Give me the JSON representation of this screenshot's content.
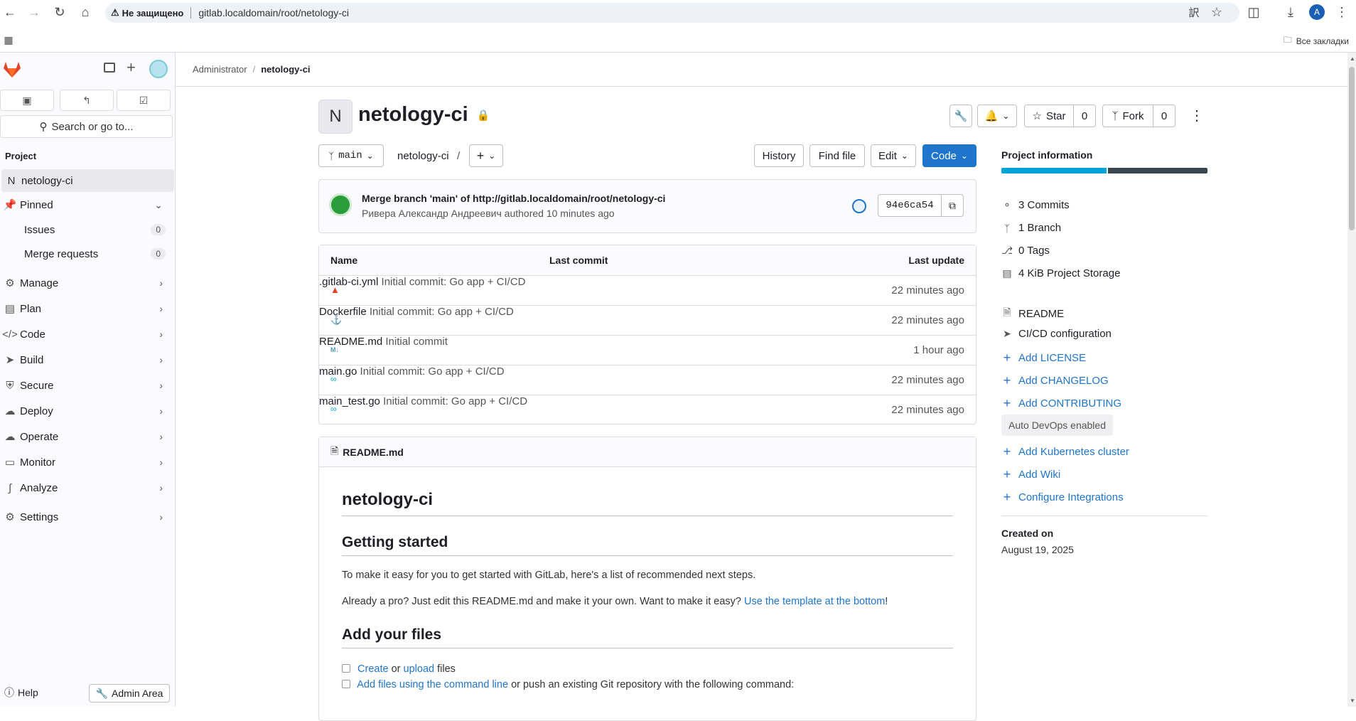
{
  "browser": {
    "security_label": "Не защищено",
    "url": "gitlab.localdomain/root/netology-ci",
    "bookmarks_label": "Все закладки",
    "profile_initial": "A"
  },
  "sidebar": {
    "search_label": "Search or go to...",
    "section_label": "Project",
    "project_initial": "N",
    "project_name": "netology-ci",
    "pinned_label": "Pinned",
    "issues_label": "Issues",
    "issues_count": "0",
    "mr_label": "Merge requests",
    "mr_count": "0",
    "items": [
      {
        "label": "Manage"
      },
      {
        "label": "Plan"
      },
      {
        "label": "Code"
      },
      {
        "label": "Build"
      },
      {
        "label": "Secure"
      },
      {
        "label": "Deploy"
      },
      {
        "label": "Operate"
      },
      {
        "label": "Monitor"
      },
      {
        "label": "Analyze"
      },
      {
        "label": "Settings"
      }
    ],
    "help_label": "Help",
    "admin_label": "Admin Area"
  },
  "breadcrumb": {
    "parent": "Administrator",
    "current": "netology-ci"
  },
  "project": {
    "initial": "N",
    "title": "netology-ci",
    "star_label": "Star",
    "star_count": "0",
    "fork_label": "Fork",
    "fork_count": "0"
  },
  "repo_toolbar": {
    "branch": "main",
    "path": "netology-ci",
    "path_sep": "/",
    "history_label": "History",
    "find_file_label": "Find file",
    "edit_label": "Edit",
    "code_label": "Code"
  },
  "commit": {
    "message": "Merge branch 'main' of http://gitlab.localdomain/root/netology-ci",
    "author_line": "Ривера Александр Андреевич authored 10 minutes ago",
    "sha": "94e6ca54"
  },
  "files": {
    "headers": {
      "name": "Name",
      "last_commit": "Last commit",
      "last_update": "Last update"
    },
    "rows": [
      {
        "name": ".gitlab-ci.yml",
        "commit": "Initial commit: Go app + CI/CD",
        "updated": "22 minutes ago"
      },
      {
        "name": "Dockerfile",
        "commit": "Initial commit: Go app + CI/CD",
        "updated": "22 minutes ago"
      },
      {
        "name": "README.md",
        "commit": "Initial commit",
        "updated": "1 hour ago"
      },
      {
        "name": "main.go",
        "commit": "Initial commit: Go app + CI/CD",
        "updated": "22 minutes ago"
      },
      {
        "name": "main_test.go",
        "commit": "Initial commit: Go app + CI/CD",
        "updated": "22 minutes ago"
      }
    ]
  },
  "readme": {
    "file_label": "README.md",
    "h1": "netology-ci",
    "h2_getting_started": "Getting started",
    "p1": "To make it easy for you to get started with GitLab, here's a list of recommended next steps.",
    "p2_text": "Already a pro? Just edit this README.md and make it your own. Want to make it easy?",
    "p2_link": "Use the template at the bottom",
    "p2_end": "!",
    "h2_add_files": "Add your files",
    "task1_link1": "Create",
    "task1_mid": "or",
    "task1_link2": "upload",
    "task1_end": "files",
    "task2_link": "Add files using the command line",
    "task2_end": "or push an existing Git repository with the following command:"
  },
  "project_info": {
    "title": "Project information",
    "commits": "3 Commits",
    "branches": "1 Branch",
    "tags": "0 Tags",
    "storage": "4 KiB Project Storage",
    "readme": "README",
    "cicd": "CI/CD configuration",
    "add_license": "Add LICENSE",
    "add_changelog": "Add CHANGELOG",
    "add_contributing": "Add CONTRIBUTING",
    "auto_devops": "Auto DevOps enabled",
    "add_k8s": "Add Kubernetes cluster",
    "add_wiki": "Add Wiki",
    "configure_integrations": "Configure Integrations",
    "created_label": "Created on",
    "created_date": "August 19, 2025"
  },
  "colors": {
    "accent": "#1f75cb",
    "storage_bar_primary": "#00a4d6",
    "storage_bar_secondary": "#3a4450"
  }
}
